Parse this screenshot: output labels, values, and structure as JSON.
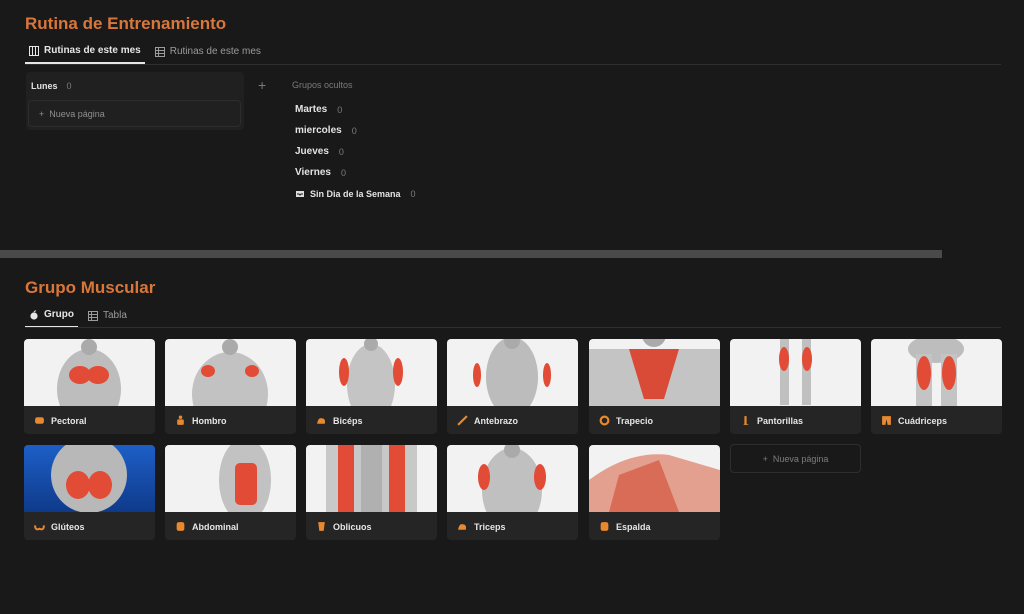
{
  "routine": {
    "title": "Rutina de Entrenamiento",
    "tabs": [
      {
        "label": "Rutinas de este mes",
        "icon": "board-icon",
        "active": true
      },
      {
        "label": "Rutinas de este mes",
        "icon": "table-icon",
        "active": false
      }
    ],
    "column": {
      "name": "Lunes",
      "count": "0",
      "new_page": "Nueva página"
    },
    "hidden_groups": {
      "title": "Grupos ocultos",
      "items": [
        {
          "name": "Martes",
          "count": "0"
        },
        {
          "name": "miercoles",
          "count": "0"
        },
        {
          "name": "Jueves",
          "count": "0"
        },
        {
          "name": "Viernes",
          "count": "0"
        },
        {
          "name": "Sin Dia de la Semana",
          "count": "0",
          "icon": "inbox-icon"
        }
      ]
    }
  },
  "muscles": {
    "title": "Grupo Muscular",
    "tabs": [
      {
        "label": "Grupo",
        "icon": "apple-icon",
        "active": true
      },
      {
        "label": "Tabla",
        "icon": "table-icon",
        "active": false
      }
    ],
    "cards": [
      {
        "label": "Pectoral",
        "icon": "chest-icon"
      },
      {
        "label": "Hombro",
        "icon": "body-icon"
      },
      {
        "label": "Bicéps",
        "icon": "flexed-arm-icon"
      },
      {
        "label": "Antebrazo",
        "icon": "forearm-icon"
      },
      {
        "label": "Trapecio",
        "icon": "circle-icon"
      },
      {
        "label": "Pantorillas",
        "icon": "leg-icon"
      },
      {
        "label": "Cuádriceps",
        "icon": "shorts-icon"
      },
      {
        "label": "Glúteos",
        "icon": "glutes-icon"
      },
      {
        "label": "Abdominal",
        "icon": "abs-icon"
      },
      {
        "label": "Oblicuos",
        "icon": "torso-icon"
      },
      {
        "label": "Triceps",
        "icon": "flexed-arm-icon"
      },
      {
        "label": "Espalda",
        "icon": "back-icon"
      }
    ],
    "new_page": "Nueva página"
  },
  "colors": {
    "accent": "#d9773b",
    "background": "#191919",
    "card": "#252525"
  }
}
